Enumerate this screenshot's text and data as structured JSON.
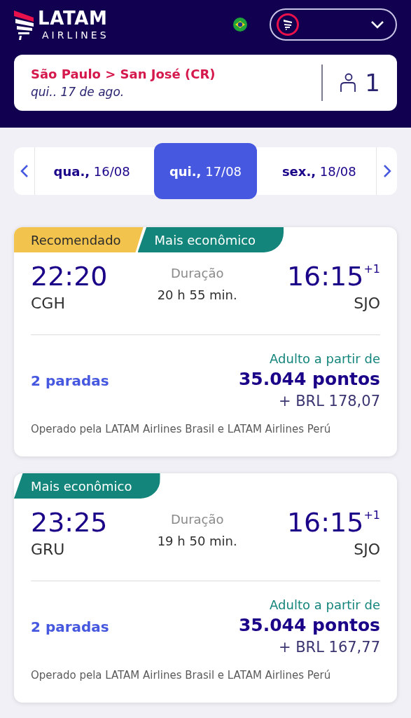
{
  "header": {
    "logo": {
      "name": "LATAM",
      "sub": "AIRLINES"
    }
  },
  "search_summary": {
    "route": "São Paulo > San José (CR)",
    "date": "qui.. 17 de ago.",
    "passengers": "1"
  },
  "date_tabs": [
    {
      "day": "qua.,",
      "date": "16/08",
      "selected": false
    },
    {
      "day": "qui.,",
      "date": "17/08",
      "selected": true
    },
    {
      "day": "sex.,",
      "date": "18/08",
      "selected": false
    }
  ],
  "flights": [
    {
      "badges": [
        {
          "kind": "recommended",
          "label": "Recomendado"
        },
        {
          "kind": "cheapest",
          "label": "Mais econômico"
        }
      ],
      "departure": "22:20",
      "origin": "CGH",
      "duration_label": "Duração",
      "duration": "20 h 55 min.",
      "arrival": "16:15",
      "day_offset": "+1",
      "destination": "SJO",
      "stops": "2 paradas",
      "price_label": "Adulto a partir de",
      "points": "35.044 pontos",
      "fee": "+ BRL 178,07",
      "operator": "Operado pela LATAM Airlines Brasil e LATAM Airlines Perú"
    },
    {
      "badges": [
        {
          "kind": "cheapest",
          "label": "Mais econômico"
        }
      ],
      "departure": "23:25",
      "origin": "GRU",
      "duration_label": "Duração",
      "duration": "19 h 50 min.",
      "arrival": "16:15",
      "day_offset": "+1",
      "destination": "SJO",
      "stops": "2 paradas",
      "price_label": "Adulto a partir de",
      "points": "35.044 pontos",
      "fee": "+ BRL 167,77",
      "operator": "Operado pela LATAM Airlines Brasil e LATAM Airlines Perú"
    }
  ]
}
